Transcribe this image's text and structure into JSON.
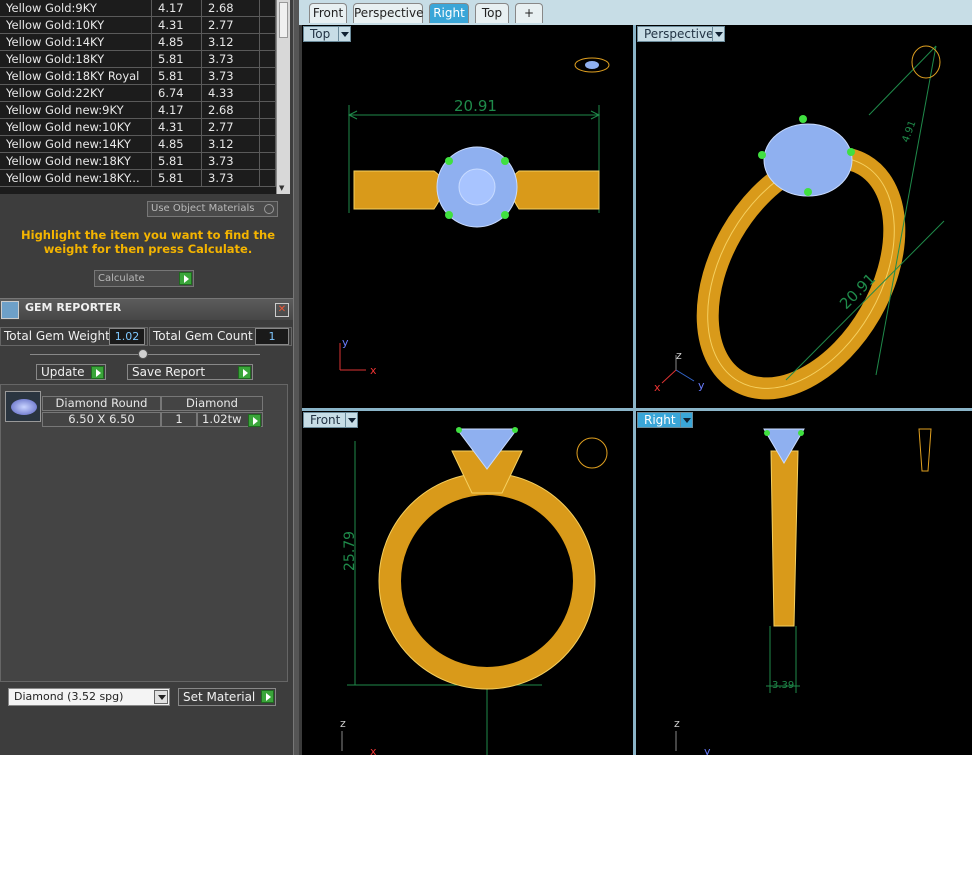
{
  "materials": {
    "rows": [
      [
        "Yellow Gold:9KY",
        "4.17",
        "2.68"
      ],
      [
        "Yellow Gold:10KY",
        "4.31",
        "2.77"
      ],
      [
        "Yellow Gold:14KY",
        "4.85",
        "3.12"
      ],
      [
        "Yellow Gold:18KY",
        "5.81",
        "3.73"
      ],
      [
        "Yellow Gold:18KY Royal",
        "5.81",
        "3.73"
      ],
      [
        "Yellow Gold:22KY",
        "6.74",
        "4.33"
      ],
      [
        "Yellow Gold new:9KY",
        "4.17",
        "2.68"
      ],
      [
        "Yellow Gold new:10KY",
        "4.31",
        "2.77"
      ],
      [
        "Yellow Gold new:14KY",
        "4.85",
        "3.12"
      ],
      [
        "Yellow Gold new:18KY",
        "5.81",
        "3.73"
      ],
      [
        "Yellow Gold new:18KY...",
        "5.81",
        "3.73"
      ]
    ],
    "use_object_materials": "Use Object Materials",
    "hint": "Highlight the item you want to find the weight for then press Calculate.",
    "calculate": "Calculate"
  },
  "gem_reporter": {
    "title": "GEM REPORTER",
    "total_weight_label": "Total Gem Weight",
    "total_weight": "1.02",
    "total_count_label": "Total Gem Count",
    "total_count": "1",
    "update": "Update",
    "save_report": "Save Report",
    "gem": {
      "name": "Diamond Round",
      "material": "Diamond",
      "size": "6.50 X 6.50",
      "count": "1",
      "weight": "1.02tw"
    },
    "material_select": "Diamond     (3.52 spg)",
    "set_material": "Set Material"
  },
  "tabs": [
    "Front",
    "Perspective",
    "Right",
    "Top",
    "+"
  ],
  "active_tab": "Right",
  "viewports": {
    "top": {
      "label": "Top",
      "dimension": "20.91",
      "axes": [
        "y",
        "x"
      ]
    },
    "perspective": {
      "label": "Perspective",
      "dimension_a": "20.91",
      "dimension_b": "4.91",
      "axes": [
        "z",
        "x",
        "y"
      ]
    },
    "front": {
      "label": "Front",
      "dimension": "25.79",
      "axes": [
        "z",
        "x"
      ]
    },
    "right": {
      "label": "Right",
      "dimension": "3.39",
      "axes": [
        "z",
        "y"
      ]
    }
  },
  "colors": {
    "gold": "#e0a020",
    "gem": "#8fb0f0",
    "prong": "#40e040",
    "dim": "#1f8a4a"
  }
}
